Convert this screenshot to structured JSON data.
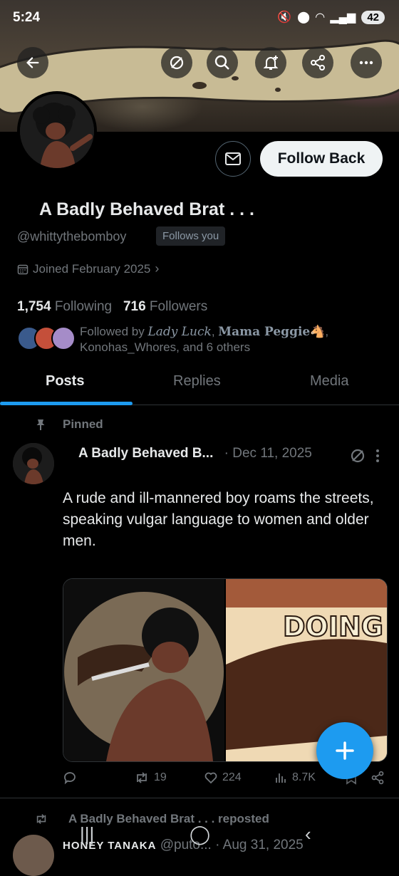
{
  "status_bar": {
    "time": "5:24",
    "battery": "42"
  },
  "profile": {
    "name": "A Badly Behaved Brat . . .",
    "handle": "@whittythebomboy",
    "follows_you": "Follows you",
    "joined": "Joined February 2025",
    "following_count": "1,754",
    "following_label": "Following",
    "followers_count": "716",
    "followers_label": "Followers",
    "followed_by_prefix": "Followed by",
    "followed_by_name1": "Lady Luck",
    "followed_by_name2": "Mama Peggie🐴",
    "followed_by_rest": "Konohas_Whores, and 6 others"
  },
  "buttons": {
    "follow_back": "Follow Back"
  },
  "tabs": [
    {
      "label": "Posts",
      "active": true
    },
    {
      "label": "Replies",
      "active": false
    },
    {
      "label": "Media",
      "active": false
    }
  ],
  "pinned_post": {
    "pinned_label": "Pinned",
    "author": "A Badly Behaved B...",
    "date": "· Dec 11, 2025",
    "text": "A rude and ill-mannered boy roams the streets, speaking vulgar language to women and older men.",
    "media_text": "DOING",
    "retweets": "19",
    "likes": "224",
    "views": "8.7K"
  },
  "next_post": {
    "repost_label": "A Badly Behaved Brat . . . reposted",
    "author": "HONEY TANAKA",
    "handle": "@puto...",
    "date": "· Aug 31, 2025"
  },
  "colors": {
    "accent": "#1d9bf0",
    "background": "#000000",
    "muted": "#71767b"
  }
}
